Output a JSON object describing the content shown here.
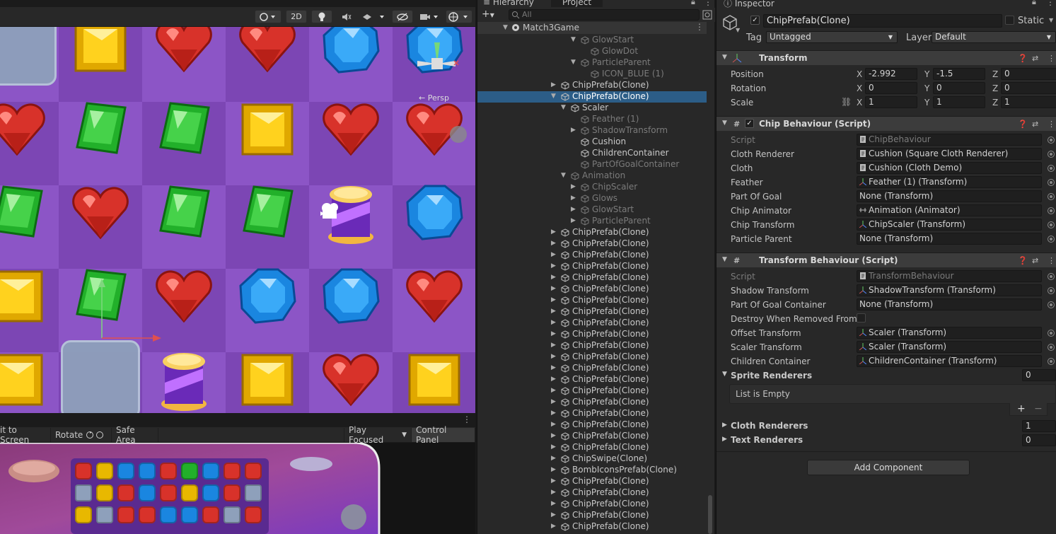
{
  "scene": {
    "toolbar": {
      "two_d_label": "2D"
    },
    "persp_label": "← Persp",
    "board": {
      "rows": [
        [
          "slot",
          "yellow",
          "heart",
          "heart",
          "blue",
          "blue"
        ],
        [
          "heart",
          "green",
          "green",
          "yellow",
          "heart",
          "heart"
        ],
        [
          "green",
          "heart",
          "green",
          "green",
          "chip",
          "blue"
        ],
        [
          "yellow",
          "green",
          "heart",
          "blue",
          "blue",
          "heart"
        ],
        [
          "yellow",
          "slot",
          "chip",
          "yellow",
          "heart",
          "yellow"
        ]
      ]
    }
  },
  "game": {
    "toolbar": {
      "fit": "it to Screen",
      "rotate": "Rotate",
      "safe_area": "Safe Area",
      "play_focused": "Play Focused",
      "control_panel": "Control Panel"
    }
  },
  "hierarchy": {
    "tab_label": "Hierarchy",
    "project_tab_label": "Project",
    "search_placeholder": "All",
    "root": "Match3Game",
    "items": [
      {
        "label": "GlowStart",
        "dim": true
      },
      {
        "label": "GlowDot",
        "dim": true
      },
      {
        "label": "ParticleParent",
        "dim": true
      },
      {
        "label": "ICON_BLUE (1)",
        "dim": true
      },
      {
        "label": "ChipPrefab(Clone)",
        "dim": false
      },
      {
        "label": "ChipPrefab(Clone)",
        "dim": false,
        "selected": true
      },
      {
        "label": "Scaler",
        "dim": false
      },
      {
        "label": "Feather (1)",
        "dim": true
      },
      {
        "label": "ShadowTransform",
        "dim": true
      },
      {
        "label": "Cushion",
        "dim": false
      },
      {
        "label": "ChildrenContainer",
        "dim": false
      },
      {
        "label": "PartOfGoalContainer",
        "dim": true
      },
      {
        "label": "Animation",
        "dim": true
      },
      {
        "label": "ChipScaler",
        "dim": true
      },
      {
        "label": "Glows",
        "dim": true
      },
      {
        "label": "GlowStart",
        "dim": true
      },
      {
        "label": "ParticleParent",
        "dim": true
      },
      {
        "label": "ChipPrefab(Clone)",
        "dim": false
      },
      {
        "label": "ChipPrefab(Clone)",
        "dim": false
      },
      {
        "label": "ChipPrefab(Clone)",
        "dim": false
      },
      {
        "label": "ChipPrefab(Clone)",
        "dim": false
      },
      {
        "label": "ChipPrefab(Clone)",
        "dim": false
      },
      {
        "label": "ChipPrefab(Clone)",
        "dim": false
      },
      {
        "label": "ChipPrefab(Clone)",
        "dim": false
      },
      {
        "label": "ChipPrefab(Clone)",
        "dim": false
      },
      {
        "label": "ChipPrefab(Clone)",
        "dim": false
      },
      {
        "label": "ChipPrefab(Clone)",
        "dim": false
      },
      {
        "label": "ChipPrefab(Clone)",
        "dim": false
      },
      {
        "label": "ChipPrefab(Clone)",
        "dim": false
      },
      {
        "label": "ChipPrefab(Clone)",
        "dim": false
      },
      {
        "label": "ChipPrefab(Clone)",
        "dim": false
      },
      {
        "label": "ChipPrefab(Clone)",
        "dim": false
      },
      {
        "label": "ChipPrefab(Clone)",
        "dim": false
      },
      {
        "label": "ChipPrefab(Clone)",
        "dim": false
      },
      {
        "label": "ChipPrefab(Clone)",
        "dim": false
      },
      {
        "label": "ChipPrefab(Clone)",
        "dim": false
      },
      {
        "label": "ChipPrefab(Clone)",
        "dim": false
      },
      {
        "label": "ChipSwipe(Clone)",
        "dim": false
      },
      {
        "label": "BombIconsPrefab(Clone)",
        "dim": false
      },
      {
        "label": "ChipPrefab(Clone)",
        "dim": false
      },
      {
        "label": "ChipPrefab(Clone)",
        "dim": false
      },
      {
        "label": "ChipPrefab(Clone)",
        "dim": false
      },
      {
        "label": "ChipPrefab(Clone)",
        "dim": false
      },
      {
        "label": "ChipPrefab(Clone)",
        "dim": false
      }
    ]
  },
  "inspector": {
    "tab_label": "Inspector",
    "object_name": "ChipPrefab(Clone)",
    "static_label": "Static",
    "tag_label": "Tag",
    "tag_value": "Untagged",
    "layer_label": "Layer",
    "layer_value": "Default",
    "transform": {
      "title": "Transform",
      "position_label": "Position",
      "rotation_label": "Rotation",
      "scale_label": "Scale",
      "x": "X",
      "y": "Y",
      "z": "Z",
      "position": [
        "-2.992",
        "-1.5",
        "0"
      ],
      "rotation": [
        "0",
        "0",
        "0"
      ],
      "scale": [
        "1",
        "1",
        "1"
      ]
    },
    "chip_behaviour": {
      "title": "Chip Behaviour (Script)",
      "fields": [
        {
          "label": "Script",
          "value": "ChipBehaviour",
          "dim": true,
          "icon": "script"
        },
        {
          "label": "Cloth Renderer",
          "value": "Cushion (Square Cloth Renderer)",
          "icon": "script"
        },
        {
          "label": "Cloth",
          "value": "Cushion (Cloth Demo)",
          "icon": "script"
        },
        {
          "label": "Feather",
          "value": "Feather (1) (Transform)",
          "icon": "transform"
        },
        {
          "label": "Part Of Goal",
          "value": "None (Transform)",
          "icon": "none"
        },
        {
          "label": "Chip Animator",
          "value": "Animation (Animator)",
          "icon": "animator"
        },
        {
          "label": "Chip Transform",
          "value": "ChipScaler (Transform)",
          "icon": "transform"
        },
        {
          "label": "Particle Parent",
          "value": "None (Transform)",
          "icon": "none"
        }
      ]
    },
    "transform_behaviour": {
      "title": "Transform Behaviour (Script)",
      "fields": [
        {
          "label": "Script",
          "value": "TransformBehaviour",
          "dim": true,
          "icon": "script"
        },
        {
          "label": "Shadow Transform",
          "value": "ShadowTransform (Transform)",
          "icon": "transform"
        },
        {
          "label": "Part Of Goal Container",
          "value": "None (Transform)",
          "icon": "none"
        },
        {
          "label": "Destroy When Removed From G",
          "value": "",
          "icon": "checkbox"
        },
        {
          "label": "Offset Transform",
          "value": "Scaler (Transform)",
          "icon": "transform"
        },
        {
          "label": "Scaler Transform",
          "value": "Scaler (Transform)",
          "icon": "transform"
        },
        {
          "label": "Children Container",
          "value": "ChildrenContainer (Transform)",
          "icon": "transform"
        }
      ],
      "sprite_renderers_label": "Sprite Renderers",
      "sprite_renderers_count": "0",
      "list_empty": "List is Empty",
      "cloth_renderers_label": "Cloth Renderers",
      "cloth_renderers_count": "1",
      "text_renderers_label": "Text Renderers",
      "text_renderers_count": "0"
    },
    "add_component_label": "Add Component"
  }
}
